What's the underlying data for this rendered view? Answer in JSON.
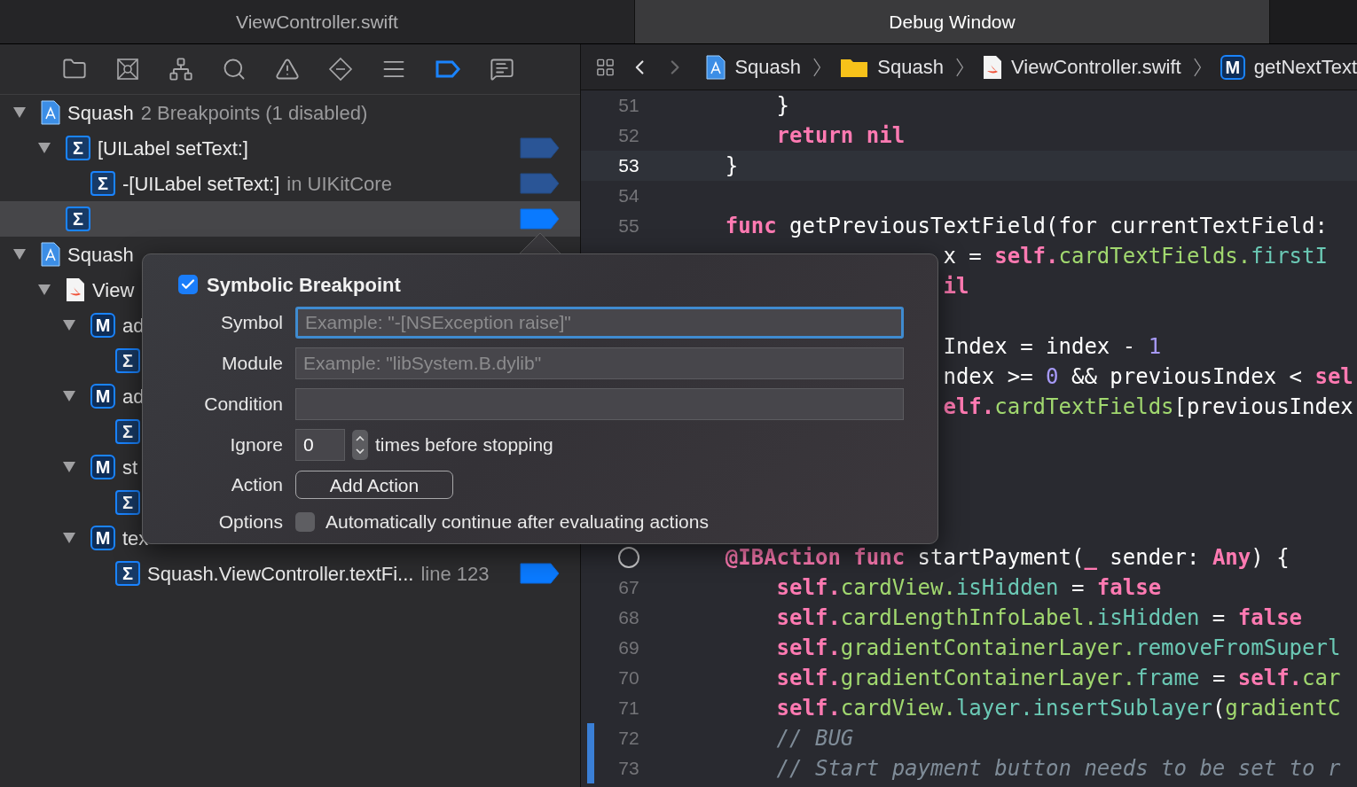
{
  "tabs": [
    {
      "label": "ViewController.swift",
      "selected": false
    },
    {
      "label": "Debug Window",
      "selected": true
    }
  ],
  "navigator_toolbar": [
    {
      "kind": "folder",
      "selected": false
    },
    {
      "kind": "source-control",
      "selected": false
    },
    {
      "kind": "hierarchy",
      "selected": false
    },
    {
      "kind": "search",
      "selected": false
    },
    {
      "kind": "warning",
      "selected": false
    },
    {
      "kind": "test",
      "selected": false
    },
    {
      "kind": "debug",
      "selected": false
    },
    {
      "kind": "breakpoint",
      "selected": true
    },
    {
      "kind": "report",
      "selected": false
    }
  ],
  "breakpoint_tree": [
    {
      "kind": "project",
      "title": "Squash",
      "detail": "2 Breakpoints (1 disabled)",
      "expanded": true,
      "selected": false,
      "children": [
        {
          "kind": "symbol",
          "badge": "Σ",
          "title": "[UILabel setText:]",
          "expanded": true,
          "selected": false,
          "breakpoint_enabled": false,
          "children": [
            {
              "kind": "symbol",
              "badge": "Σ",
              "title": "-[UILabel setText:]",
              "detail": "in UIKitCore",
              "selected": false,
              "breakpoint_enabled": false
            }
          ]
        },
        {
          "kind": "symbol",
          "badge": "Σ",
          "selected": true,
          "breakpoint_enabled": true
        }
      ]
    },
    {
      "kind": "project",
      "title": "Squash",
      "expanded": true,
      "selected": false,
      "children": [
        {
          "kind": "file",
          "title": "View",
          "expanded": true,
          "selected": false,
          "children": [
            {
              "kind": "method",
              "badge": "M",
              "title": "ad",
              "expanded": true,
              "selected": false,
              "children": [
                {
                  "kind": "symbol",
                  "badge": "Σ",
                  "selected": false
                }
              ]
            },
            {
              "kind": "method",
              "badge": "M",
              "title": "ad",
              "expanded": true,
              "selected": false,
              "children": [
                {
                  "kind": "symbol",
                  "badge": "Σ",
                  "selected": false
                }
              ]
            },
            {
              "kind": "method",
              "badge": "M",
              "title": "st",
              "expanded": true,
              "selected": false,
              "children": [
                {
                  "kind": "symbol",
                  "badge": "Σ",
                  "selected": false
                }
              ]
            },
            {
              "kind": "method",
              "badge": "M",
              "title": "tex",
              "expanded": true,
              "selected": false,
              "children": [
                {
                  "kind": "symbol",
                  "badge": "Σ",
                  "title": "Squash.ViewController.textFi...",
                  "detail": "line 123",
                  "selected": false,
                  "breakpoint_enabled": true
                }
              ]
            }
          ]
        }
      ]
    }
  ],
  "breadcrumbs": [
    {
      "kind": "project",
      "label": "Squash"
    },
    {
      "kind": "folder",
      "label": "Squash"
    },
    {
      "kind": "file",
      "label": "ViewController.swift"
    },
    {
      "kind": "method",
      "badge": "M",
      "label": "getNextText"
    }
  ],
  "nav_buttons": [
    {
      "kind": "back",
      "disabled": false
    },
    {
      "kind": "forward",
      "disabled": true
    }
  ],
  "code_lines": [
    {
      "kind": "code",
      "number": "51",
      "tokens": [
        {
          "t": "        }",
          "kind": "plain"
        }
      ]
    },
    {
      "kind": "code",
      "number": "52",
      "tokens": [
        {
          "t": "        return",
          "kind": "keyword"
        },
        {
          "t": " nil",
          "kind": "keyword"
        }
      ]
    },
    {
      "kind": "code",
      "number": "53",
      "current": true,
      "tokens": [
        {
          "t": "    }",
          "kind": "plain"
        }
      ]
    },
    {
      "kind": "code",
      "number": "54",
      "current": false
    },
    {
      "kind": "code",
      "number": "55",
      "tokens": [
        {
          "t": "    func",
          "kind": "keyword"
        },
        {
          "t": " getPreviousTextField(for currentTextField:",
          "kind": "plain"
        }
      ]
    },
    {
      "kind": "code",
      "tokens": [
        {
          "t": "                     x = ",
          "kind": "plain"
        },
        {
          "t": "self.",
          "kind": "keyword"
        },
        {
          "t": "cardTextFields.",
          "kind": "project"
        },
        {
          "t": "firstI",
          "kind": "system"
        }
      ]
    },
    {
      "kind": "code",
      "tokens": [
        {
          "t": "                     il",
          "kind": "keyword"
        }
      ]
    },
    {
      "kind": "hidden"
    },
    {
      "kind": "code",
      "tokens": [
        {
          "t": "                     Index = index - ",
          "kind": "plain"
        },
        {
          "t": "1",
          "kind": "number"
        }
      ]
    },
    {
      "kind": "code",
      "tokens": [
        {
          "t": "                     ndex >= ",
          "kind": "plain"
        },
        {
          "t": "0",
          "kind": "number"
        },
        {
          "t": " && previousIndex < ",
          "kind": "plain"
        },
        {
          "t": "sel",
          "kind": "keyword"
        }
      ]
    },
    {
      "kind": "code",
      "tokens": [
        {
          "t": "                     elf.",
          "kind": "keyword"
        },
        {
          "t": "cardTextFields",
          "kind": "project"
        },
        {
          "t": "[previousIndex",
          "kind": "plain"
        }
      ]
    },
    {
      "kind": "hidden"
    },
    {
      "kind": "hidden"
    },
    {
      "kind": "hidden"
    },
    {
      "kind": "hidden"
    },
    {
      "kind": "code",
      "breakpoint_marker": true,
      "tokens": [
        {
          "t": "    @IBAction",
          "kind": "keyword"
        },
        {
          "t": " func",
          "kind": "keyword"
        },
        {
          "t": " startPayment(",
          "kind": "plain"
        },
        {
          "t": "_",
          "kind": "keyword"
        },
        {
          "t": " sender: ",
          "kind": "plain"
        },
        {
          "t": "Any",
          "kind": "keyword"
        },
        {
          "t": ") {",
          "kind": "plain"
        }
      ]
    },
    {
      "kind": "code",
      "number": "67",
      "tokens": [
        {
          "t": "        self.",
          "kind": "keyword"
        },
        {
          "t": "cardView.",
          "kind": "project"
        },
        {
          "t": "isHidden",
          "kind": "system"
        },
        {
          "t": " = ",
          "kind": "plain"
        },
        {
          "t": "false",
          "kind": "keyword"
        }
      ]
    },
    {
      "kind": "code",
      "number": "68",
      "tokens": [
        {
          "t": "        self.",
          "kind": "keyword"
        },
        {
          "t": "cardLengthInfoLabel.",
          "kind": "project"
        },
        {
          "t": "isHidden",
          "kind": "system"
        },
        {
          "t": " = ",
          "kind": "plain"
        },
        {
          "t": "false",
          "kind": "keyword"
        }
      ]
    },
    {
      "kind": "code",
      "number": "69",
      "tokens": [
        {
          "t": "        self.",
          "kind": "keyword"
        },
        {
          "t": "gradientContainerLayer.",
          "kind": "project"
        },
        {
          "t": "removeFromSuperl",
          "kind": "system"
        }
      ]
    },
    {
      "kind": "code",
      "number": "70",
      "tokens": [
        {
          "t": "        self.",
          "kind": "keyword"
        },
        {
          "t": "gradientContainerLayer.",
          "kind": "project"
        },
        {
          "t": "frame",
          "kind": "system"
        },
        {
          "t": " = ",
          "kind": "plain"
        },
        {
          "t": "self.",
          "kind": "keyword"
        },
        {
          "t": "car",
          "kind": "project"
        }
      ]
    },
    {
      "kind": "code",
      "number": "71",
      "tokens": [
        {
          "t": "        self.",
          "kind": "keyword"
        },
        {
          "t": "cardView.",
          "kind": "project"
        },
        {
          "t": "layer.insertSublayer",
          "kind": "system"
        },
        {
          "t": "(",
          "kind": "plain"
        },
        {
          "t": "gradientC",
          "kind": "project"
        }
      ]
    },
    {
      "kind": "code",
      "number": "72",
      "changed": true,
      "tokens": [
        {
          "t": "        // BUG",
          "kind": "comment"
        }
      ]
    },
    {
      "kind": "code",
      "number": "73",
      "changed": true,
      "tokens": [
        {
          "t": "        // Start payment button needs to be set to r",
          "kind": "comment"
        }
      ]
    }
  ],
  "popover": {
    "enabled_label": "Symbolic Breakpoint",
    "enabled": true,
    "fields": [
      {
        "label": "Symbol",
        "placeholder": "Example: \"-[NSException raise]\"",
        "focused": true
      },
      {
        "label": "Module",
        "placeholder": "Example: \"libSystem.B.dylib\"",
        "focused": false
      },
      {
        "label": "Condition",
        "focused": false
      }
    ],
    "ignore": {
      "label": "Ignore",
      "value": "0",
      "suffix": "times before stopping"
    },
    "action": {
      "label": "Action",
      "button": "Add Action"
    },
    "options": {
      "label": "Options",
      "checkbox_label": "Automatically continue after evaluating actions",
      "checked": false
    }
  }
}
